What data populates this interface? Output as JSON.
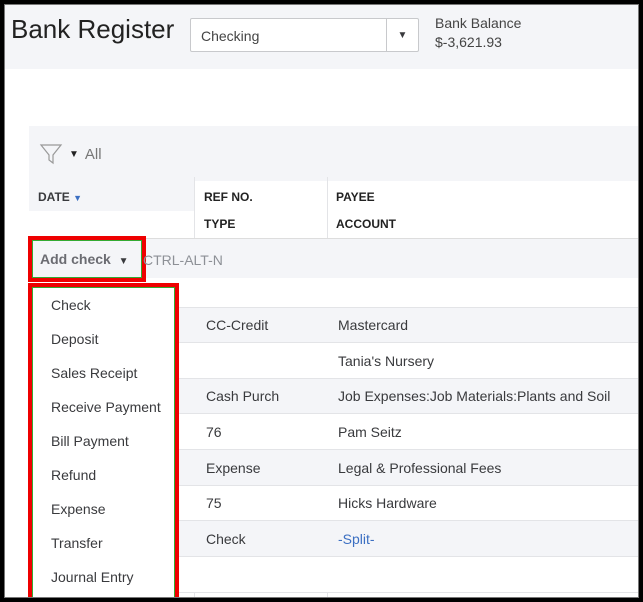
{
  "header": {
    "title": "Bank Register",
    "account": "Checking",
    "balance_label": "Bank Balance",
    "balance": "$-3,621.93"
  },
  "filter": {
    "label": "All"
  },
  "columns": {
    "date": "DATE",
    "ref": "REF NO.",
    "type": "TYPE",
    "payee": "PAYEE",
    "account": "ACCOUNT"
  },
  "add": {
    "label": "Add check",
    "shortcut": "CTRL-ALT-N"
  },
  "menu": [
    "Check",
    "Deposit",
    "Sales Receipt",
    "Receive Payment",
    "Bill Payment",
    "Refund",
    "Expense",
    "Transfer",
    "Journal Entry"
  ],
  "rows": [
    {
      "ref": "",
      "payee": ""
    },
    {
      "ref": "CC-Credit",
      "payee": "Mastercard"
    },
    {
      "ref": "",
      "payee": "Tania's Nursery"
    },
    {
      "ref": "Cash Purch",
      "payee": "Job Expenses:Job Materials:Plants and Soil"
    },
    {
      "ref": "76",
      "payee": "Pam Seitz"
    },
    {
      "ref": "Expense",
      "payee": "Legal & Professional Fees"
    },
    {
      "ref": "75",
      "payee": "Hicks Hardware"
    },
    {
      "ref": "Check",
      "payee": "-Split-"
    },
    {
      "ref": "",
      "payee": ""
    }
  ],
  "colors": {
    "highlight": "#ee0000",
    "link": "#3b6fc2"
  }
}
